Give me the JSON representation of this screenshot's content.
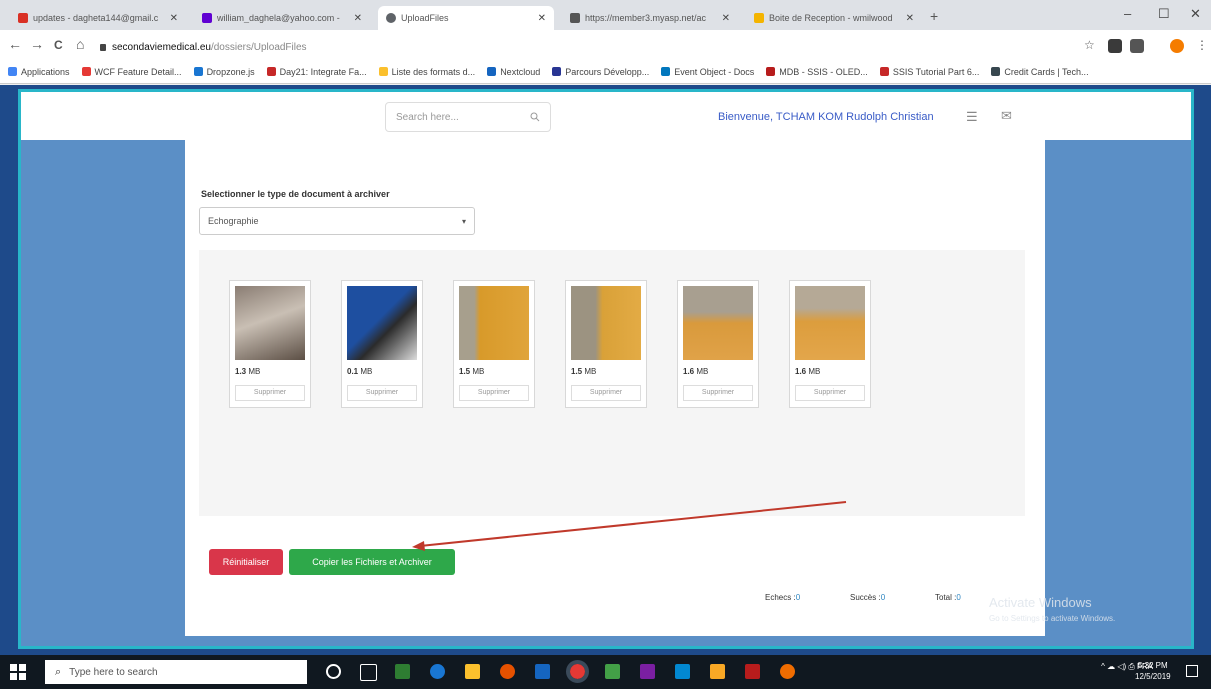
{
  "browser": {
    "tabs": [
      {
        "label": "updates - dagheta144@gmail.c",
        "active": false,
        "icon_color": "#d93025"
      },
      {
        "label": "william_daghela@yahoo.com -",
        "active": false,
        "icon_color": "#6001d2"
      },
      {
        "label": "UploadFiles",
        "active": true,
        "icon_color": "#5f6368"
      },
      {
        "label": "https://member3.myasp.net/ac",
        "active": false,
        "icon_color": "#555555"
      },
      {
        "label": "Boite de Reception - wmilwood",
        "active": false,
        "icon_color": "#f4b400"
      }
    ],
    "new_tab": "+",
    "window_controls": {
      "minimize": "–",
      "maximize": "☐",
      "close": "✕"
    },
    "nav": {
      "back": "←",
      "forward": "→",
      "reload": "C",
      "home": "⌂"
    },
    "url_domain": "secondaviemedical.eu",
    "url_path": "/dossiers/UploadFiles",
    "bookmarks": [
      {
        "label": "Applications",
        "color": "#4285f4"
      },
      {
        "label": "WCF Feature Detail...",
        "color": "#e53935"
      },
      {
        "label": "Dropzone.js",
        "color": "#1976d2"
      },
      {
        "label": "Day21: Integrate Fa...",
        "color": "#c62828"
      },
      {
        "label": "Liste des formats d...",
        "color": "#fbc02d"
      },
      {
        "label": "Nextcloud",
        "color": "#1565c0"
      },
      {
        "label": "Parcours Développ...",
        "color": "#283593"
      },
      {
        "label": "Event Object - Docs",
        "color": "#0277bd"
      },
      {
        "label": "MDB - SSIS - OLED...",
        "color": "#b71c1c"
      },
      {
        "label": "SSIS Tutorial Part 6...",
        "color": "#c62828"
      },
      {
        "label": "Credit Cards | Tech...",
        "color": "#37474f"
      }
    ]
  },
  "header": {
    "search_placeholder": "Search here...",
    "search_icon": "search-icon",
    "welcome": "Bienvenue, TCHAM KOM Rudolph Christian",
    "list_icon": "list-icon",
    "mail_icon": "mail-icon"
  },
  "form": {
    "doc_type_label": "Selectionner le type de document à archiver",
    "doc_type_value": "Echographie",
    "files": [
      {
        "size": "1.3",
        "unit": "MB",
        "remove": "Supprimer",
        "colors": [
          "#8a7d73",
          "#c9bfb4",
          "#5c4f45"
        ]
      },
      {
        "size": "0.1",
        "unit": "MB",
        "remove": "Supprimer",
        "colors": [
          "#1e4fa0",
          "#2b2b2b",
          "#dcdcdc"
        ]
      },
      {
        "size": "1.5",
        "unit": "MB",
        "remove": "Supprimer",
        "colors": [
          "#d89a2a",
          "#a79f8d",
          "#e0a43a"
        ]
      },
      {
        "size": "1.5",
        "unit": "MB",
        "remove": "Supprimer",
        "colors": [
          "#d9a138",
          "#9c9381",
          "#e3ab45"
        ]
      },
      {
        "size": "1.6",
        "unit": "MB",
        "remove": "Supprimer",
        "colors": [
          "#a89f90",
          "#d99a3c",
          "#e0a248"
        ]
      },
      {
        "size": "1.6",
        "unit": "MB",
        "remove": "Supprimer",
        "colors": [
          "#b5a996",
          "#dc9d3d",
          "#e3a64b"
        ]
      }
    ],
    "reset_label": "Réinitialiser",
    "copy_label": "Copier les Fichiers et Archiver",
    "stats": {
      "echecs_label": "Echecs :",
      "echecs_value": "0",
      "succes_label": "Succès :",
      "succes_value": "0",
      "total_label": "Total :",
      "total_value": "0"
    }
  },
  "watermark": {
    "line1": "Activate Windows",
    "line2": "Go to Settings to activate Windows."
  },
  "taskbar": {
    "search_placeholder": "Type here to search",
    "app_colors": [
      "#ffffff",
      "#ffffff",
      "#2e7d32",
      "#1976d2",
      "#fbc02d",
      "#e65100",
      "#1565c0",
      "#e53935",
      "#43a047",
      "#7b1fa2",
      "#0288d1",
      "#f9a825",
      "#b71c1c",
      "#ef6c00"
    ],
    "tray": "^  ☁  ◁)  ⎙  FRA",
    "time": "5:32 PM",
    "date": "12/5/2019"
  },
  "colors": {
    "accent": "#3a5cc7",
    "danger": "#d9364a",
    "success": "#2ea84a",
    "page_bg": "#5b8fc6",
    "frame": "#29b6c9",
    "annotation": "#c0392b"
  }
}
